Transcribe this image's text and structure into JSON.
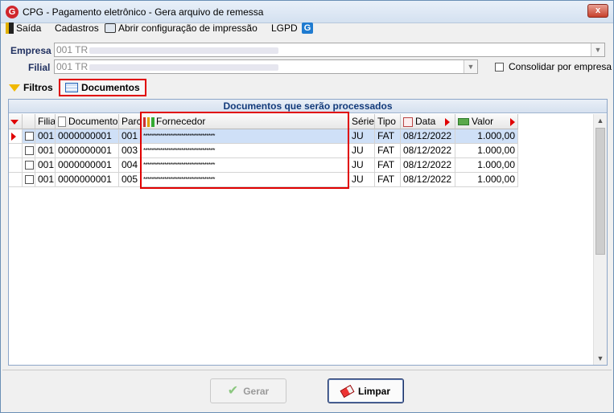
{
  "window": {
    "title": "CPG - Pagamento eletrônico - Gera arquivo de remessa",
    "close_glyph": "x"
  },
  "menu": {
    "items": [
      "Saída",
      "Cadastros",
      "Abrir configuração de impressão",
      "LGPD"
    ]
  },
  "filters": {
    "empresa_label": "Empresa",
    "empresa_value": "001 TR",
    "filial_label": "Filial",
    "filial_value": "001 TR",
    "consolidar_label": "Consolidar por empresa",
    "consolidar_checked": false
  },
  "tabs": [
    {
      "label": "Filtros",
      "active": false
    },
    {
      "label": "Documentos",
      "active": true
    }
  ],
  "grid": {
    "title": "Documentos que serão processados",
    "columns": [
      "Filial",
      "Documento",
      "Parc",
      "Fornecedor",
      "Série",
      "Tipo",
      "Data",
      "Valor"
    ],
    "rows": [
      {
        "filial": "001",
        "documento": "0000000001",
        "parcela": "001",
        "fornecedor": "**********************************",
        "serie": "JU",
        "tipo": "FAT",
        "data": "08/12/2022",
        "valor": "1.000,00",
        "selected": true
      },
      {
        "filial": "001",
        "documento": "0000000001",
        "parcela": "003",
        "fornecedor": "**********************************",
        "serie": "JU",
        "tipo": "FAT",
        "data": "08/12/2022",
        "valor": "1.000,00",
        "selected": false
      },
      {
        "filial": "001",
        "documento": "0000000001",
        "parcela": "004",
        "fornecedor": "**********************************",
        "serie": "JU",
        "tipo": "FAT",
        "data": "08/12/2022",
        "valor": "1.000,00",
        "selected": false
      },
      {
        "filial": "001",
        "documento": "0000000001",
        "parcela": "005",
        "fornecedor": "**********************************",
        "serie": "JU",
        "tipo": "FAT",
        "data": "08/12/2022",
        "valor": "1.000,00",
        "selected": false
      }
    ]
  },
  "buttons": {
    "gerar_label": "Gerar",
    "limpar_label": "Limpar"
  },
  "colors": {
    "highlight": "#e00000",
    "selected_row": "#cfe0f7",
    "grid_title": "#123a7a"
  }
}
